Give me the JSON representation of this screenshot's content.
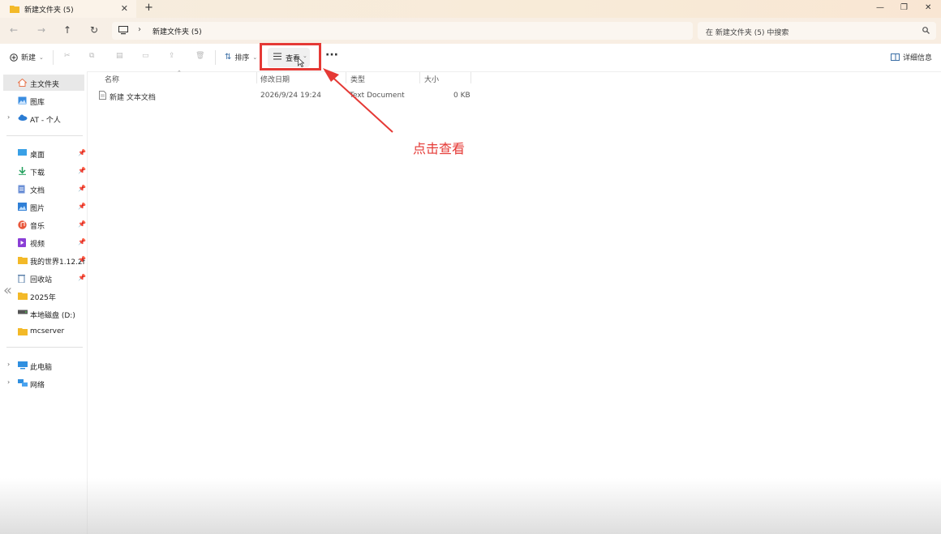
{
  "tab": {
    "title": "新建文件夹 (5)"
  },
  "address": {
    "path": "新建文件夹 (5)",
    "search_placeholder": "在 新建文件夹 (5) 中搜索"
  },
  "toolbar": {
    "new_label": "新建",
    "sort_label": "排序",
    "view_label": "查看",
    "details_label": "详细信息"
  },
  "sidebar": {
    "top": [
      {
        "label": "主文件夹",
        "icon": "home-icon"
      },
      {
        "label": "图库",
        "icon": "gallery-icon"
      },
      {
        "label": "AT - 个人",
        "icon": "cloud-icon"
      }
    ],
    "pinned": [
      {
        "label": "桌面",
        "icon": "desktop-icon"
      },
      {
        "label": "下载",
        "icon": "download-icon"
      },
      {
        "label": "文档",
        "icon": "document-icon"
      },
      {
        "label": "图片",
        "icon": "pictures-icon"
      },
      {
        "label": "音乐",
        "icon": "music-icon"
      },
      {
        "label": "视频",
        "icon": "video-icon"
      },
      {
        "label": "我的世界1.12.2f",
        "icon": "folder-icon"
      },
      {
        "label": "回收站",
        "icon": "recycle-bin-icon"
      },
      {
        "label": "2025年",
        "icon": "folder-icon"
      },
      {
        "label": "本地磁盘 (D:)",
        "icon": "drive-icon"
      },
      {
        "label": "mcserver",
        "icon": "folder-icon"
      }
    ],
    "bottom": [
      {
        "label": "此电脑",
        "icon": "pc-icon"
      },
      {
        "label": "网络",
        "icon": "network-icon"
      }
    ]
  },
  "columns": {
    "name": "名称",
    "modified": "修改日期",
    "type": "类型",
    "size": "大小"
  },
  "files": [
    {
      "name": "新建 文本文档",
      "modified": "2026/9/24 19:24",
      "type": "Text Document",
      "size": "0 KB"
    }
  ],
  "annotation": {
    "text": "点击查看",
    "color": "#e53935"
  }
}
